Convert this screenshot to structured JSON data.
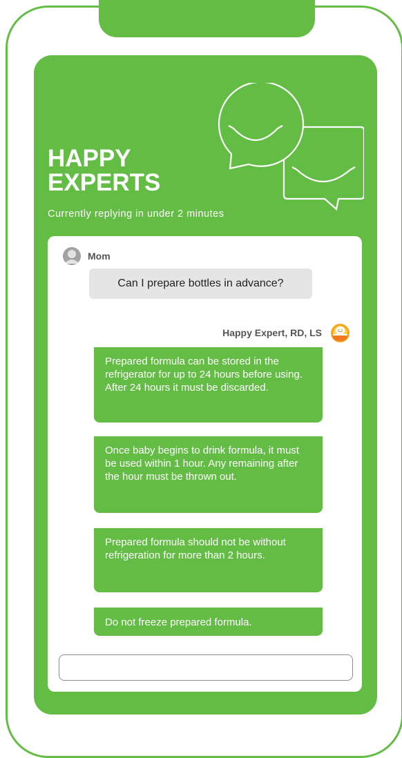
{
  "header": {
    "title_line1": "HAPPY",
    "title_line2": "EXPERTS",
    "subtitle": "Currently replying in under 2 minutes"
  },
  "chat": {
    "user": {
      "name": "Mom",
      "message": "Can I prepare bottles in advance?",
      "avatar_icon": "user-silhouette-icon"
    },
    "expert": {
      "name": "Happy Expert, RD, LS",
      "avatar_icon": "happy-baby-sun-icon",
      "messages": [
        "Prepared formula can be stored in the refrigerator for up to 24 hours before using. After 24 hours it must be discarded.",
        "Once baby begins to drink formula, it must be used within 1 hour. Any remaining after the hour must be thrown out.",
        "Prepared formula should not be without refrigeration for more than 2 hours.",
        "Do not freeze prepared formula."
      ]
    },
    "input": {
      "value": "",
      "placeholder": ""
    }
  },
  "colors": {
    "brand_green": "#63bd45",
    "bubble_gray": "#e5e5e5",
    "name_gray": "#555555"
  }
}
